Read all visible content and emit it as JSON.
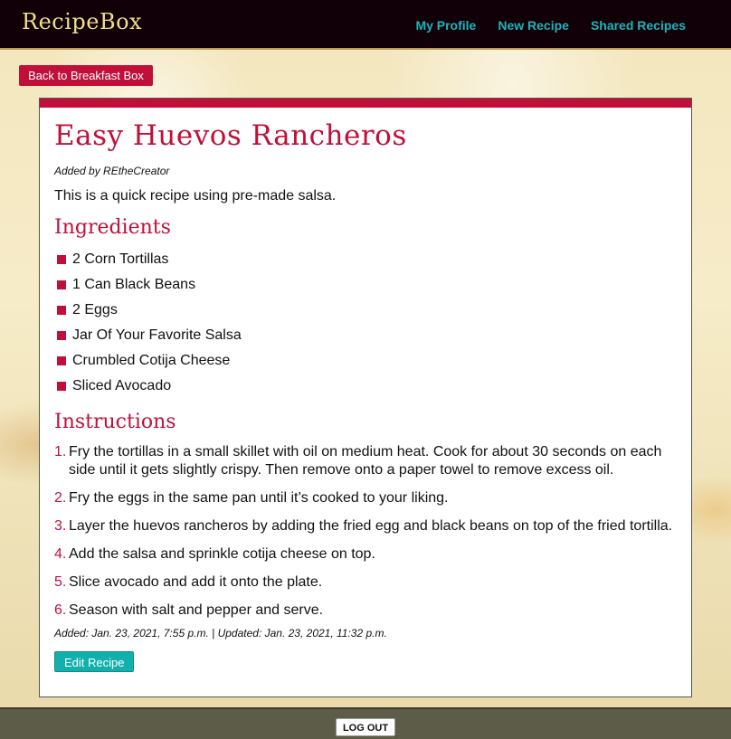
{
  "nav": {
    "brand": "RecipeBox",
    "links": [
      "My Profile",
      "New Recipe",
      "Shared Recipes"
    ]
  },
  "back_button": "Back to Breakfast Box",
  "recipe": {
    "title": "Easy Huevos Rancheros",
    "author": "Added by REtheCreator",
    "description": "This is a quick recipe using pre-made salsa.",
    "ingredients_heading": "Ingredients",
    "ingredients": [
      "2 Corn Tortillas",
      "1 Can Black Beans",
      "2 Eggs",
      "Jar Of Your Favorite Salsa",
      "Crumbled Cotija Cheese",
      "Sliced Avocado"
    ],
    "instructions_heading": "Instructions",
    "instructions": [
      "Fry the tortillas in a small skillet with oil on medium heat. Cook for about 30 seconds on each side until it gets slightly crispy. Then remove onto a paper towel to remove excess oil.",
      "Fry the eggs in the same pan until it’s cooked to your liking.",
      "Layer the huevos rancheros by adding the fried egg and black beans on top of the fried tortilla.",
      "Add the salsa and sprinkle cotija cheese on top.",
      "Slice avocado and add it onto the plate.",
      "Season with salt and pepper and serve."
    ],
    "meta": "Added: Jan. 23, 2021, 7:55 p.m. | Updated: Jan. 23, 2021, 11:32 p.m.",
    "edit_button": "Edit Recipe"
  },
  "footer": {
    "logout": "LOG OUT"
  },
  "colors": {
    "accent": "#c0103a",
    "nav_link": "#1fb3b8",
    "brand": "#f2df8c",
    "navbar_bg": "#110008",
    "edit_button": "#12b0ad"
  }
}
